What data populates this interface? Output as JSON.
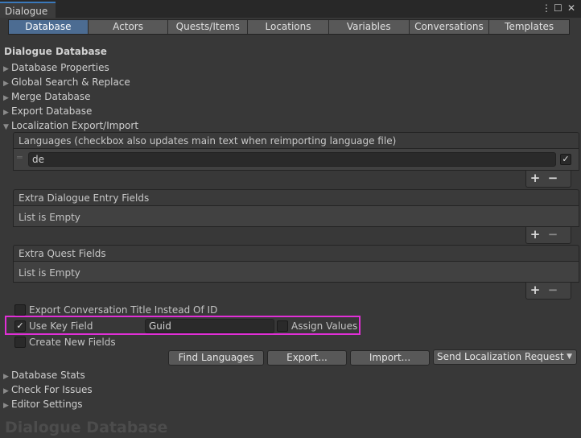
{
  "window": {
    "title": "Dialogue",
    "more_icon": "⋮",
    "maximize_icon": "☐",
    "close_icon": "✕"
  },
  "toolbar": {
    "tabs": [
      "Database",
      "Actors",
      "Quests/Items",
      "Locations",
      "Variables",
      "Conversations",
      "Templates"
    ],
    "active": "Database"
  },
  "section_title": "Dialogue Database",
  "foldouts": {
    "database_properties": "Database Properties",
    "global_search": "Global Search & Replace",
    "merge": "Merge Database",
    "export": "Export Database",
    "localization": "Localization Export/Import",
    "stats": "Database Stats",
    "check_issues": "Check For Issues",
    "editor_settings": "Editor Settings"
  },
  "languages": {
    "header": "Languages (checkbox also updates main text when reimporting language file)",
    "items": [
      {
        "value": "de",
        "checked": true
      }
    ],
    "add": "+",
    "remove": "−"
  },
  "extra_entry_fields": {
    "header": "Extra Dialogue Entry Fields",
    "empty_text": "List is Empty",
    "add": "+",
    "remove": "−"
  },
  "extra_quest_fields": {
    "header": "Extra Quest Fields",
    "empty_text": "List is Empty",
    "add": "+",
    "remove": "−"
  },
  "options": {
    "export_title": {
      "label": "Export Conversation Title Instead Of ID",
      "checked": false
    },
    "use_key_field": {
      "label": "Use Key Field",
      "checked": true,
      "value": "Guid"
    },
    "assign_values": {
      "label": "Assign Values",
      "checked": false
    },
    "create_new_fields": {
      "label": "Create New Fields",
      "checked": false
    }
  },
  "buttons": {
    "find_languages": "Find Languages",
    "export": "Export...",
    "import": "Import...",
    "send_request": "Send Localization Request",
    "dropdown_arrow": "▼"
  },
  "watermark": "Dialogue Database",
  "colors": {
    "active_tab": "#4c6c92",
    "highlight": "#e12fd7",
    "background": "#383838"
  }
}
